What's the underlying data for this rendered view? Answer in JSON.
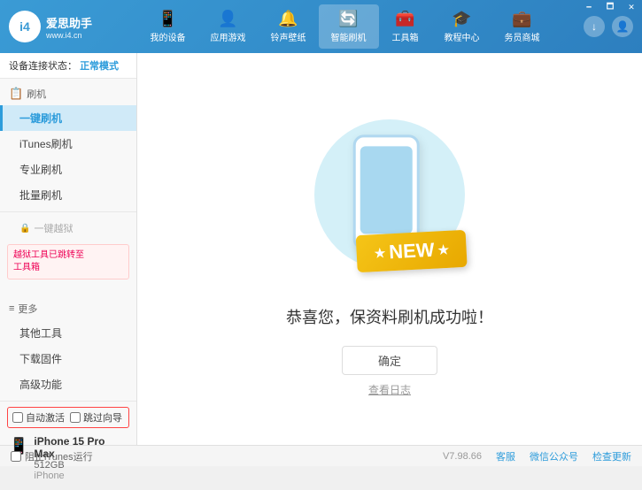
{
  "header": {
    "logo": {
      "symbol": "i4",
      "brand": "爱思助手",
      "url": "www.i4.cn"
    },
    "nav": [
      {
        "id": "my-device",
        "icon": "📱",
        "label": "我的设备"
      },
      {
        "id": "apps-games",
        "icon": "👤",
        "label": "应用游戏"
      },
      {
        "id": "ringtones",
        "icon": "🔔",
        "label": "铃声壁纸"
      },
      {
        "id": "smart-flash",
        "icon": "🔄",
        "label": "智能刷机",
        "active": true
      },
      {
        "id": "toolbox",
        "icon": "🧰",
        "label": "工具箱"
      },
      {
        "id": "tutorials",
        "icon": "🎓",
        "label": "教程中心"
      },
      {
        "id": "service",
        "icon": "💼",
        "label": "务员商城"
      }
    ],
    "window_controls": [
      "min",
      "max",
      "close"
    ]
  },
  "sidebar": {
    "status_label": "设备连接状态：",
    "status_value": "正常模式",
    "flash_group": "刷机",
    "items": [
      {
        "id": "one-key-flash",
        "label": "一键刷机",
        "active": true
      },
      {
        "id": "itunes-flash",
        "label": "iTunes刷机"
      },
      {
        "id": "pro-flash",
        "label": "专业刷机"
      },
      {
        "id": "batch-flash",
        "label": "批量刷机"
      }
    ],
    "disabled_item": "一键越狱",
    "warning_text": "越狱工具已跳转至\n工具箱",
    "more_group": "更多",
    "more_items": [
      {
        "id": "other-tools",
        "label": "其他工具"
      },
      {
        "id": "download-fw",
        "label": "下载固件"
      },
      {
        "id": "advanced",
        "label": "高级功能"
      }
    ],
    "auto_activate_label": "自动激活",
    "guide_activate_label": "跳过向导",
    "device": {
      "name": "iPhone 15 Pro Max",
      "storage": "512GB",
      "type": "iPhone"
    }
  },
  "content": {
    "new_badge": "NEW",
    "success_title": "恭喜您，保资料刷机成功啦！",
    "confirm_button": "确定",
    "view_log": "查看日志"
  },
  "footer": {
    "itunes_label": "阻止iTunes运行",
    "version": "V7.98.66",
    "links": [
      "客服",
      "微信公众号",
      "检查更新"
    ]
  }
}
